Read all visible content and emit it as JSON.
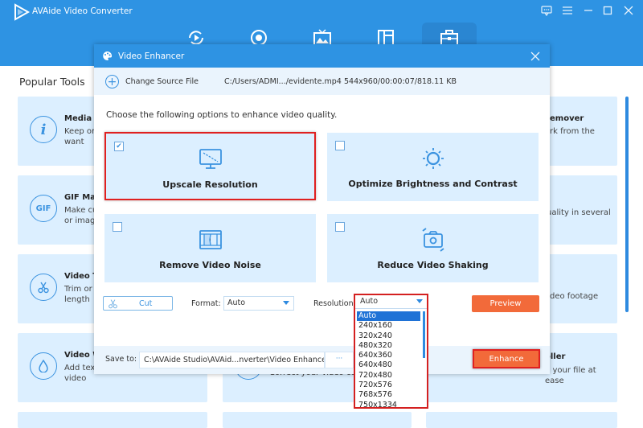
{
  "app": {
    "title": "AVAide Video Converter",
    "window_controls": [
      "feedback-icon",
      "menu-icon",
      "minimize-icon",
      "maximize-icon",
      "close-icon"
    ]
  },
  "nav": {
    "items": [
      {
        "icon": "converter-icon",
        "active": false
      },
      {
        "icon": "record-icon",
        "active": false
      },
      {
        "icon": "mv-icon",
        "active": false
      },
      {
        "icon": "collage-icon",
        "active": false
      },
      {
        "icon": "toolbox-icon",
        "active": true
      }
    ]
  },
  "background": {
    "section_title": "Popular Tools",
    "tools": [
      {
        "name": "Media Metadata Editor",
        "short": "Media M",
        "desc": "Keep orig",
        "desc2": "want",
        "icon": "info-icon"
      },
      {
        "name": "GIF Maker",
        "short": "GIF Mak",
        "desc": "Make cus",
        "desc2": "or image",
        "icon": "gif-icon"
      },
      {
        "name": "Video Trimmer",
        "short": "Video Tr",
        "desc": "Trim or c",
        "desc2": "length",
        "icon": "scissors-icon"
      },
      {
        "name": "Video Watermark",
        "short": "Video W",
        "desc": "Add text",
        "desc2": "video",
        "icon": "drop-icon"
      }
    ],
    "right_tools": [
      {
        "name_fragment": "emover",
        "desc_fragment": "rk from the"
      },
      {
        "name_fragment": "",
        "desc_fragment": "uality in several"
      },
      {
        "name_fragment": "",
        "desc_fragment": "deo footage"
      },
      {
        "name_fragment": "oller",
        "desc_fragment": "n your file at",
        "desc2": "ease"
      }
    ],
    "middle_tool_desc": "Correct your video color"
  },
  "dialog": {
    "title": "Video Enhancer",
    "change_source_label": "Change Source File",
    "file_path": "C:/Users/ADMI.../evidente.mp4",
    "file_info": "544x960/00:00:07/818.11 KB",
    "instructions": "Choose the following options to enhance video quality.",
    "options": [
      {
        "label": "Upscale Resolution",
        "checked": true,
        "icon": "monitor-icon"
      },
      {
        "label": "Optimize Brightness and Contrast",
        "checked": false,
        "icon": "brightness-icon"
      },
      {
        "label": "Remove Video Noise",
        "checked": false,
        "icon": "film-icon"
      },
      {
        "label": "Reduce Video Shaking",
        "checked": false,
        "icon": "camera-icon"
      }
    ],
    "cut_label": "Cut",
    "format_label": "Format:",
    "format_value": "Auto",
    "resolution_label": "Resolution:",
    "resolution_value": "Auto",
    "resolution_options": [
      "Auto",
      "240x160",
      "320x240",
      "480x320",
      "640x360",
      "640x480",
      "720x480",
      "720x576",
      "768x576",
      "750x1334"
    ],
    "resolution_selected_index": 0,
    "preview_label": "Preview",
    "save_label": "Save to:",
    "save_path": "C:\\AVAide Studio\\AVAid...nverter\\Video Enhancer",
    "browse_label": "···",
    "enhance_label": "Enhance"
  },
  "colors": {
    "brand_blue": "#2e93e3",
    "accent_orange": "#f26a3a",
    "highlight_red": "#e02020",
    "card_bg": "#dcefff"
  }
}
